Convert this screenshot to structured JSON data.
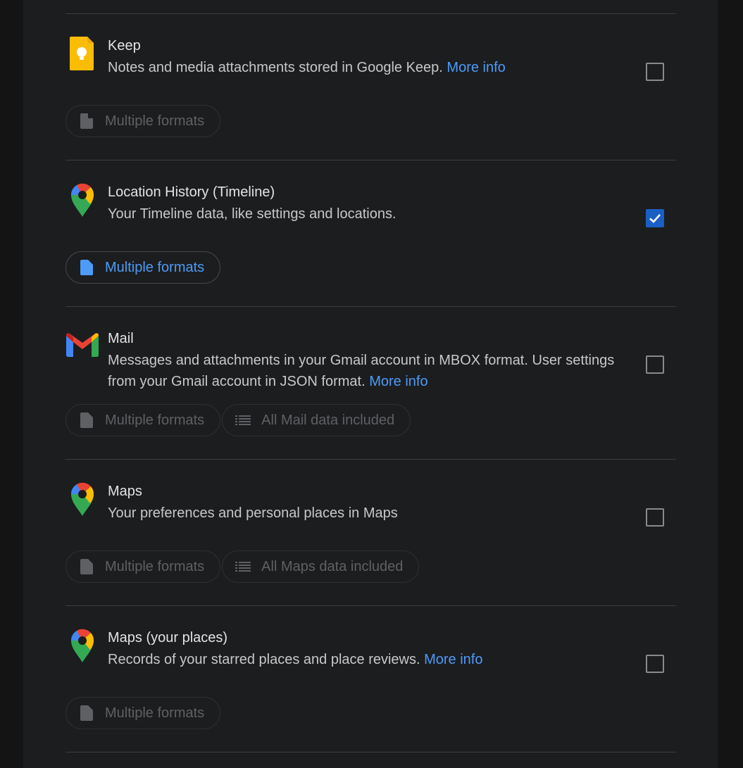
{
  "items": [
    {
      "title": "Keep",
      "description": "Notes and media attachments stored in Google Keep.",
      "more_info": "More info",
      "icon": "keep-icon",
      "checked": false,
      "chips": [
        {
          "label": "Multiple formats",
          "icon": "file-icon",
          "active": false
        }
      ]
    },
    {
      "title": "Location History (Timeline)",
      "description": "Your Timeline data, like settings and locations.",
      "more_info": "",
      "icon": "maps-pin-icon",
      "checked": true,
      "chips": [
        {
          "label": "Multiple formats",
          "icon": "file-icon",
          "active": true
        }
      ]
    },
    {
      "title": "Mail",
      "description": "Messages and attachments in your Gmail account in MBOX format. User settings from your Gmail account in JSON format.",
      "more_info": "More info",
      "icon": "gmail-icon",
      "checked": false,
      "chips": [
        {
          "label": "Multiple formats",
          "icon": "file-icon",
          "active": false
        },
        {
          "label": "All Mail data included",
          "icon": "list-icon",
          "active": false
        }
      ]
    },
    {
      "title": "Maps",
      "description": "Your preferences and personal places in Maps",
      "more_info": "",
      "icon": "maps-pin-icon",
      "checked": false,
      "chips": [
        {
          "label": "Multiple formats",
          "icon": "file-icon",
          "active": false
        },
        {
          "label": "All Maps data included",
          "icon": "list-icon",
          "active": false
        }
      ]
    },
    {
      "title": "Maps (your places)",
      "description": "Records of your starred places and place reviews.",
      "more_info": "More info",
      "icon": "maps-pin-icon",
      "checked": false,
      "chips": [
        {
          "label": "Multiple formats",
          "icon": "file-icon",
          "active": false
        }
      ]
    }
  ],
  "colors": {
    "accent": "#4d9bf7",
    "checkbox_checked": "#1a5fc4",
    "background": "#1c1d1f"
  }
}
